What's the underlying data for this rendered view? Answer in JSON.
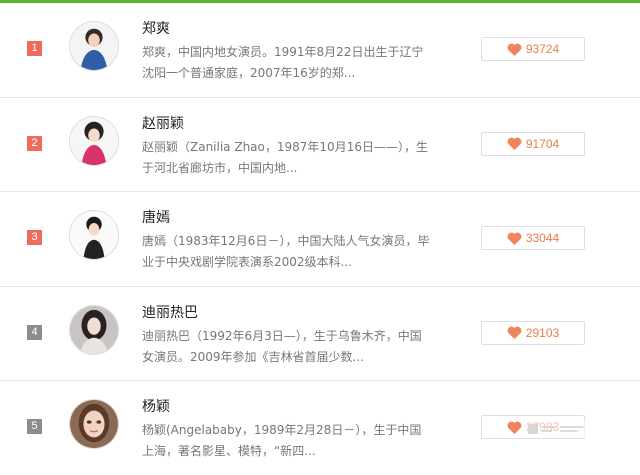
{
  "accent_color": "#5cb531",
  "heart_color": "#f0845b",
  "rank_colors": {
    "top": "#ee6b5f",
    "other": "#8c8c8c"
  },
  "stars": [
    {
      "rank": "1",
      "rank_tier": "top",
      "name": "郑爽",
      "desc": "郑爽，中国内地女演员。1991年8月22日出生于辽宁沈阳一个普通家庭，2007年16岁的郑...",
      "likes": "93724",
      "avatar_icon": "woman-avatar"
    },
    {
      "rank": "2",
      "rank_tier": "top",
      "name": "赵丽颖",
      "desc": "赵丽颖（Zanilia Zhao，1987年10月16日——），生于河北省廊坊市，中国内地...",
      "likes": "91704",
      "avatar_icon": "woman-avatar"
    },
    {
      "rank": "3",
      "rank_tier": "top",
      "name": "唐嫣",
      "desc": "唐嫣（1983年12月6日－），中国大陆人气女演员，毕业于中央戏剧学院表演系2002级本科...",
      "likes": "33044",
      "avatar_icon": "woman-avatar"
    },
    {
      "rank": "4",
      "rank_tier": "other",
      "name": "迪丽热巴",
      "desc": "迪丽热巴（1992年6月3日—），生于乌鲁木齐，中国女演员。2009年参加《吉林省首届少数...",
      "likes": "29103",
      "avatar_icon": "woman-avatar"
    },
    {
      "rank": "5",
      "rank_tier": "other",
      "name": "杨颖",
      "desc": "杨颖(Angelababy，1989年2月28日－），生于中国上海，著名影星、模特，“新四...",
      "likes": "27983",
      "avatar_icon": "woman-avatar"
    }
  ]
}
